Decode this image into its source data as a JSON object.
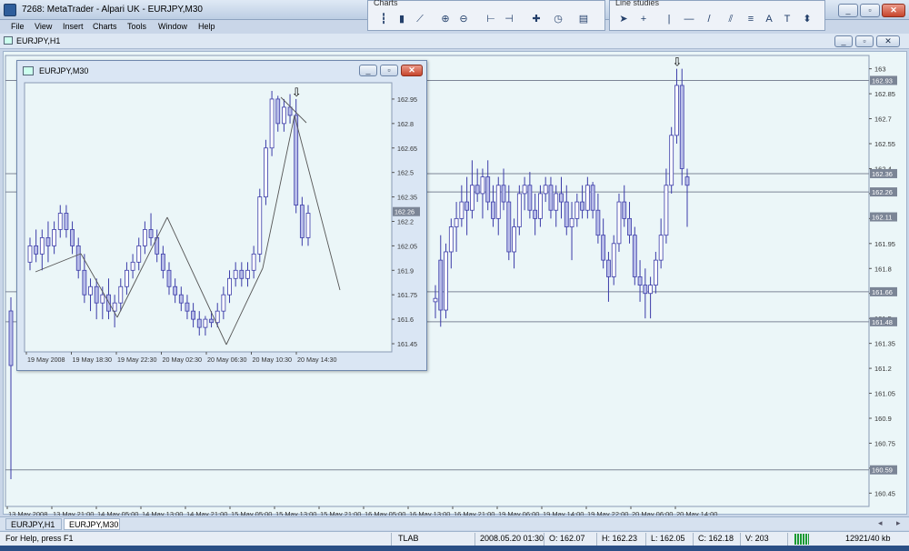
{
  "app": {
    "title": "7268: MetaTrader - Alpari UK - EURJPY,M30",
    "minimize_label": "_",
    "restore_label": "▫",
    "close_label": "✕"
  },
  "toolbars": {
    "charts": {
      "title": "Charts",
      "buttons": [
        {
          "name": "bar-chart-icon",
          "glyph": "┇"
        },
        {
          "name": "candlestick-icon",
          "glyph": "▮"
        },
        {
          "name": "line-chart-icon",
          "glyph": "⟋"
        },
        {
          "name": "zoom-in-icon",
          "glyph": "⊕"
        },
        {
          "name": "zoom-out-icon",
          "glyph": "⊖"
        },
        {
          "name": "chart-shift-icon",
          "glyph": "⊢"
        },
        {
          "name": "autoscroll-icon",
          "glyph": "⊣"
        },
        {
          "name": "indicators-icon",
          "glyph": "✚"
        },
        {
          "name": "periods-icon",
          "glyph": "◷"
        },
        {
          "name": "templates-icon",
          "glyph": "▤"
        }
      ]
    },
    "line_studies": {
      "title": "Line studies",
      "buttons": [
        {
          "name": "cursor-icon",
          "glyph": "➤"
        },
        {
          "name": "crosshair-icon",
          "glyph": "+"
        },
        {
          "name": "vertical-line-icon",
          "glyph": "|"
        },
        {
          "name": "horizontal-line-icon",
          "glyph": "—"
        },
        {
          "name": "trendline-icon",
          "glyph": "/"
        },
        {
          "name": "channel-icon",
          "glyph": "⫽"
        },
        {
          "name": "fibonacci-icon",
          "glyph": "≡"
        },
        {
          "name": "text-icon",
          "glyph": "A"
        },
        {
          "name": "text-label-icon",
          "glyph": "T"
        },
        {
          "name": "arrows-icon",
          "glyph": "⬍"
        }
      ]
    }
  },
  "menu": [
    "File",
    "View",
    "Insert",
    "Charts",
    "Tools",
    "Window",
    "Help"
  ],
  "main_window": {
    "title": "EURJPY,H1"
  },
  "child_window": {
    "title": "EURJPY,M30"
  },
  "tabs": [
    {
      "label": "EURJPY,H1",
      "active": false
    },
    {
      "label": "EURJPY,M30",
      "active": true
    }
  ],
  "status": {
    "help": "For Help, press F1",
    "profile": "TLAB",
    "datetime": "2008.05.20 01:30",
    "open": "O: 162.07",
    "high": "H: 162.23",
    "low": "L: 162.05",
    "close": "C: 162.18",
    "volume": "V: 203",
    "traffic": "12921/40 kb"
  },
  "chart_data": [
    {
      "type": "candlestick",
      "title": "EURJPY,H1",
      "y_ticks": [
        163.0,
        162.85,
        162.7,
        162.55,
        162.4,
        162.25,
        162.1,
        161.95,
        161.8,
        161.65,
        161.5,
        161.35,
        161.2,
        161.05,
        160.9,
        160.75,
        160.6,
        160.45
      ],
      "ylim": [
        160.37,
        163.08
      ],
      "x_ticks": [
        "13 May 2008",
        "13 May 21:00",
        "14 May 05:00",
        "14 May 13:00",
        "14 May 21:00",
        "15 May 05:00",
        "15 May 13:00",
        "15 May 21:00",
        "16 May 05:00",
        "16 May 13:00",
        "16 May 21:00",
        "19 May 06:00",
        "19 May 14:00",
        "19 May 22:00",
        "20 May 06:00",
        "20 May 14:00"
      ],
      "price_labels": [
        {
          "value": 162.93,
          "label": "162.93"
        },
        {
          "value": 162.37,
          "label": "162.36"
        },
        {
          "value": 162.26,
          "label": "162.26"
        },
        {
          "value": 162.11,
          "label": "162.11"
        },
        {
          "value": 161.66,
          "label": "161.66"
        },
        {
          "value": 161.48,
          "label": "161.48"
        },
        {
          "value": 160.59,
          "label": "160.59"
        }
      ],
      "horizontal_lines": [
        162.93,
        162.37,
        162.26,
        161.66,
        161.48,
        160.59
      ],
      "arrow_marker": {
        "label": "⇩",
        "candle_index": 46
      },
      "candles": [
        [
          161.6,
          161.7,
          161.5,
          161.62
        ],
        [
          161.85,
          162.0,
          161.45,
          161.55
        ],
        [
          161.55,
          161.95,
          161.5,
          161.9
        ],
        [
          161.9,
          162.1,
          161.8,
          162.05
        ],
        [
          162.05,
          162.2,
          161.9,
          162.1
        ],
        [
          162.1,
          162.3,
          162.05,
          162.2
        ],
        [
          162.2,
          162.35,
          162.0,
          162.15
        ],
        [
          162.15,
          162.45,
          162.1,
          162.3
        ],
        [
          162.3,
          162.4,
          162.2,
          162.25
        ],
        [
          162.25,
          162.4,
          162.1,
          162.35
        ],
        [
          162.35,
          162.45,
          162.15,
          162.2
        ],
        [
          162.2,
          162.3,
          162.05,
          162.1
        ],
        [
          162.1,
          162.35,
          162.0,
          162.3
        ],
        [
          162.3,
          162.4,
          162.15,
          162.2
        ],
        [
          162.2,
          162.3,
          161.85,
          161.9
        ],
        [
          161.9,
          162.1,
          161.8,
          162.05
        ],
        [
          162.05,
          162.3,
          162.0,
          162.25
        ],
        [
          162.25,
          162.35,
          162.15,
          162.3
        ],
        [
          162.3,
          162.38,
          162.1,
          162.15
        ],
        [
          162.15,
          162.25,
          162.0,
          162.1
        ],
        [
          162.1,
          162.3,
          162.05,
          162.25
        ],
        [
          162.25,
          162.35,
          162.2,
          162.3
        ],
        [
          162.3,
          162.35,
          162.1,
          162.15
        ],
        [
          162.15,
          162.3,
          162.05,
          162.25
        ],
        [
          162.25,
          162.35,
          162.1,
          162.2
        ],
        [
          162.2,
          162.3,
          162.0,
          162.05
        ],
        [
          162.05,
          162.2,
          161.85,
          162.1
        ],
        [
          162.1,
          162.25,
          162.05,
          162.2
        ],
        [
          162.2,
          162.3,
          162.1,
          162.15
        ],
        [
          162.15,
          162.35,
          162.1,
          162.3
        ],
        [
          162.3,
          162.32,
          162.1,
          162.15
        ],
        [
          162.15,
          162.25,
          161.95,
          162.0
        ],
        [
          162.0,
          162.1,
          161.8,
          161.85
        ],
        [
          161.85,
          161.9,
          161.6,
          161.75
        ],
        [
          161.75,
          162.0,
          161.7,
          161.95
        ],
        [
          161.95,
          162.25,
          161.9,
          162.2
        ],
        [
          162.2,
          162.3,
          162.05,
          162.1
        ],
        [
          162.1,
          162.2,
          161.95,
          162.0
        ],
        [
          162.0,
          162.05,
          161.7,
          161.75
        ],
        [
          161.75,
          161.85,
          161.6,
          161.7
        ],
        [
          161.7,
          161.8,
          161.5,
          161.65
        ],
        [
          161.65,
          161.75,
          161.5,
          161.7
        ],
        [
          161.7,
          161.9,
          161.65,
          161.85
        ],
        [
          161.85,
          162.1,
          161.8,
          162.0
        ],
        [
          162.0,
          162.4,
          161.95,
          162.3
        ],
        [
          162.3,
          162.65,
          162.25,
          162.6
        ],
        [
          162.6,
          163.0,
          162.55,
          162.9
        ],
        [
          162.9,
          163.0,
          162.3,
          162.4
        ],
        [
          162.35,
          162.4,
          162.05,
          162.3
        ]
      ]
    },
    {
      "type": "candlestick",
      "title": "EURJPY,M30",
      "y_ticks": [
        162.95,
        162.8,
        162.65,
        162.5,
        162.35,
        162.2,
        162.05,
        161.9,
        161.75,
        161.6,
        161.45
      ],
      "ylim": [
        161.4,
        163.05
      ],
      "x_ticks": [
        "19 May 2008",
        "19 May 18:30",
        "19 May 22:30",
        "20 May 02:30",
        "20 May 06:30",
        "20 May 10:30",
        "20 May 14:30"
      ],
      "price_labels": [
        {
          "value": 162.26,
          "label": "162.26"
        }
      ],
      "arrow_marker": {
        "label": "⇩",
        "candle_index": 44
      },
      "candles": [
        [
          161.95,
          162.1,
          161.9,
          162.05
        ],
        [
          162.05,
          162.15,
          161.95,
          162.0
        ],
        [
          162.0,
          162.15,
          161.9,
          162.1
        ],
        [
          162.1,
          162.2,
          161.95,
          162.05
        ],
        [
          162.05,
          162.2,
          162.0,
          162.15
        ],
        [
          162.15,
          162.3,
          162.1,
          162.25
        ],
        [
          162.25,
          162.3,
          162.1,
          162.15
        ],
        [
          162.15,
          162.2,
          162.0,
          162.05
        ],
        [
          162.05,
          162.1,
          161.85,
          161.9
        ],
        [
          161.9,
          162.0,
          161.7,
          161.75
        ],
        [
          161.75,
          161.85,
          161.65,
          161.8
        ],
        [
          161.8,
          161.85,
          161.6,
          161.7
        ],
        [
          161.7,
          161.8,
          161.6,
          161.75
        ],
        [
          161.75,
          161.85,
          161.6,
          161.65
        ],
        [
          161.65,
          161.75,
          161.55,
          161.7
        ],
        [
          161.7,
          161.85,
          161.65,
          161.8
        ],
        [
          161.8,
          161.95,
          161.75,
          161.9
        ],
        [
          161.9,
          162.0,
          161.85,
          161.95
        ],
        [
          161.95,
          162.1,
          161.9,
          162.05
        ],
        [
          162.05,
          162.2,
          162.0,
          162.15
        ],
        [
          162.15,
          162.25,
          162.05,
          162.1
        ],
        [
          162.1,
          162.15,
          161.95,
          162.0
        ],
        [
          162.0,
          162.05,
          161.85,
          161.9
        ],
        [
          161.9,
          161.95,
          161.75,
          161.8
        ],
        [
          161.8,
          161.85,
          161.7,
          161.75
        ],
        [
          161.75,
          161.8,
          161.65,
          161.7
        ],
        [
          161.7,
          161.75,
          161.6,
          161.65
        ],
        [
          161.65,
          161.7,
          161.55,
          161.6
        ],
        [
          161.6,
          161.65,
          161.5,
          161.55
        ],
        [
          161.55,
          161.62,
          161.5,
          161.6
        ],
        [
          161.6,
          161.65,
          161.55,
          161.58
        ],
        [
          161.58,
          161.7,
          161.55,
          161.65
        ],
        [
          161.65,
          161.8,
          161.6,
          161.75
        ],
        [
          161.75,
          161.9,
          161.7,
          161.85
        ],
        [
          161.85,
          161.95,
          161.8,
          161.9
        ],
        [
          161.9,
          161.95,
          161.8,
          161.85
        ],
        [
          161.85,
          161.95,
          161.8,
          161.9
        ],
        [
          161.9,
          162.05,
          161.85,
          162.0
        ],
        [
          162.0,
          162.4,
          161.95,
          162.35
        ],
        [
          162.35,
          162.7,
          162.3,
          162.65
        ],
        [
          162.65,
          163.0,
          162.6,
          162.95
        ],
        [
          162.95,
          162.97,
          162.75,
          162.8
        ],
        [
          162.8,
          162.95,
          162.75,
          162.9
        ],
        [
          162.9,
          162.98,
          162.8,
          162.85
        ],
        [
          162.85,
          162.95,
          162.25,
          162.3
        ],
        [
          162.3,
          162.35,
          162.05,
          162.1
        ],
        [
          162.1,
          162.3,
          162.05,
          162.25
        ]
      ]
    }
  ]
}
